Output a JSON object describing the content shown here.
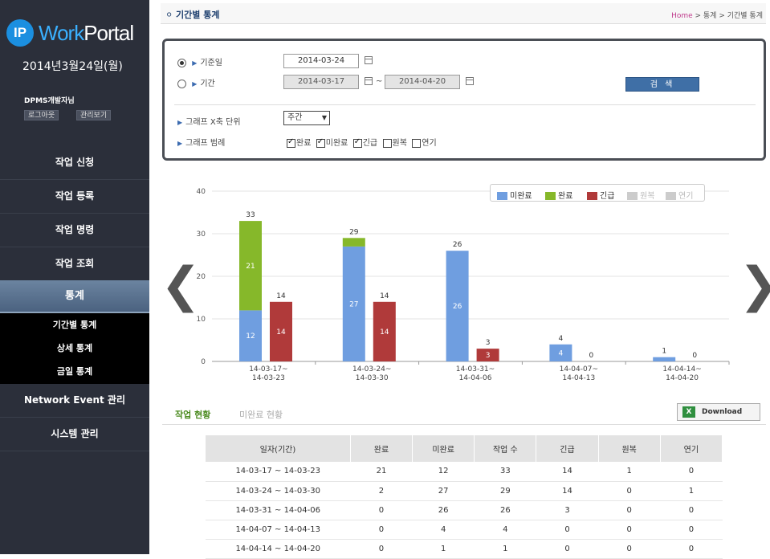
{
  "sidebar": {
    "logo_badge": "IP",
    "logo_word1": "Work",
    "logo_word2": "Portal",
    "date": "2014년3월24일(월)",
    "user": "DPMS개발자님",
    "logout": "로그아웃",
    "admin": "관리보기",
    "menu": [
      "작업 신청",
      "작업 등록",
      "작업 명령",
      "작업 조회",
      "통계"
    ],
    "submenu": [
      "기간별 통계",
      "상세 통계",
      "금일 통계"
    ],
    "menu2": [
      "Network Event 관리",
      "시스템 관리"
    ]
  },
  "header": {
    "title": "기간별 통계",
    "breadcrumb_home": "Home",
    "breadcrumb_rest": " > 통계 > 기간별 통계"
  },
  "filter": {
    "base_date_label": "기준일",
    "base_date": "2014-03-24",
    "period_label": "기간",
    "period_from": "2014-03-17",
    "period_sep": "~",
    "period_to": "2014-04-20",
    "search_label": "검 색",
    "unit_label": "그래프 X축 단위",
    "unit_value": "주간",
    "legend_label": "그래프 범례",
    "checks": [
      {
        "label": "완료",
        "checked": true
      },
      {
        "label": "미완료",
        "checked": true
      },
      {
        "label": "긴급",
        "checked": true
      },
      {
        "label": "원복",
        "checked": false
      },
      {
        "label": "연기",
        "checked": false
      }
    ]
  },
  "chart_data": {
    "type": "bar",
    "categories": [
      [
        "14-03-17~",
        "14-03-23"
      ],
      [
        "14-03-24~",
        "14-03-30"
      ],
      [
        "14-03-31~",
        "14-04-06"
      ],
      [
        "14-04-07~",
        "14-04-13"
      ],
      [
        "14-04-14~",
        "14-04-20"
      ]
    ],
    "ylim": [
      0,
      40
    ],
    "yticks": [
      0,
      10,
      20,
      30,
      40
    ],
    "stack_totals": [
      33,
      29,
      26,
      4,
      1
    ],
    "series": [
      {
        "name": "미완료",
        "values": [
          12,
          27,
          26,
          4,
          1
        ],
        "color": "#6f9ee0",
        "stack": "a"
      },
      {
        "name": "완료",
        "values": [
          21,
          2,
          0,
          0,
          0
        ],
        "color": "#86b82a",
        "stack": "a"
      },
      {
        "name": "긴급",
        "values": [
          14,
          14,
          3,
          0,
          0
        ],
        "color": "#b03a3a",
        "stack": "b"
      }
    ],
    "legend": [
      {
        "name": "미완료",
        "color": "#6f9ee0",
        "enabled": true
      },
      {
        "name": "완료",
        "color": "#86b82a",
        "enabled": true
      },
      {
        "name": "긴급",
        "color": "#b03a3a",
        "enabled": true
      },
      {
        "name": "원복",
        "color": "#cccccc",
        "enabled": false
      },
      {
        "name": "연기",
        "color": "#cccccc",
        "enabled": false
      }
    ],
    "legend_position": "top-right",
    "grid": true
  },
  "tabs": [
    "작업 현황",
    "미완료 현황"
  ],
  "download_label": "Download",
  "table": {
    "headers": [
      "일자(기간)",
      "완료",
      "미완료",
      "작업 수",
      "긴급",
      "원복",
      "연기"
    ],
    "rows": [
      [
        "14-03-17 ~ 14-03-23",
        "21",
        "12",
        "33",
        "14",
        "1",
        "0"
      ],
      [
        "14-03-24 ~ 14-03-30",
        "2",
        "27",
        "29",
        "14",
        "0",
        "1"
      ],
      [
        "14-03-31 ~ 14-04-06",
        "0",
        "26",
        "26",
        "3",
        "0",
        "0"
      ],
      [
        "14-04-07 ~ 14-04-13",
        "0",
        "4",
        "4",
        "0",
        "0",
        "0"
      ],
      [
        "14-04-14 ~ 14-04-20",
        "0",
        "1",
        "1",
        "0",
        "0",
        "0"
      ]
    ]
  }
}
